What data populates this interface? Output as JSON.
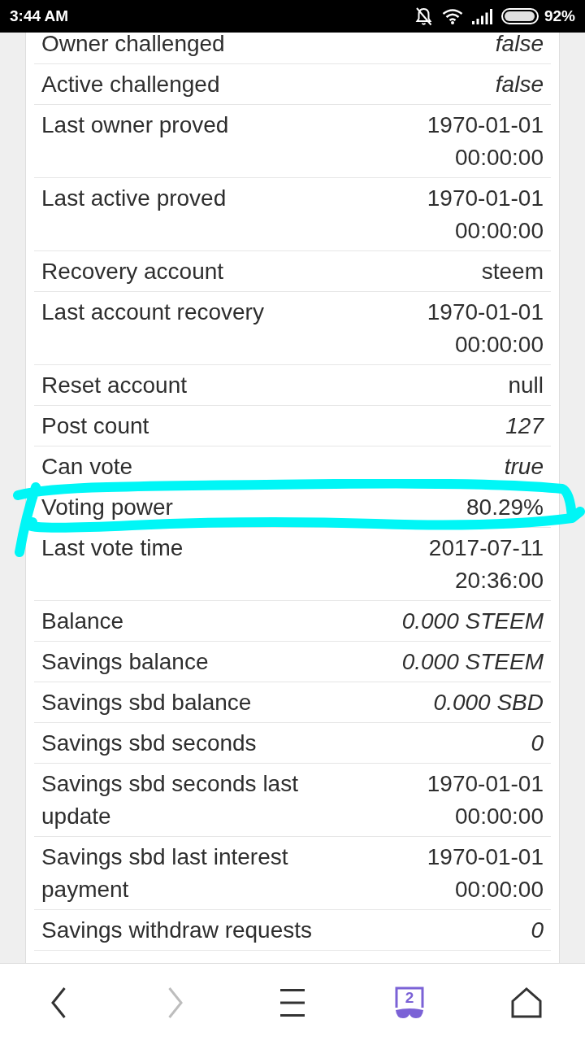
{
  "status_bar": {
    "time": "3:44 AM",
    "battery": "92%"
  },
  "rows": [
    {
      "label": "Owner challenged",
      "value": "false",
      "kind": "boolean",
      "highlighted": false
    },
    {
      "label": "Active challenged",
      "value": "false",
      "kind": "boolean",
      "highlighted": false
    },
    {
      "label": "Last owner proved",
      "value": "1970-01-01 00:00:00",
      "kind": "date",
      "highlighted": false
    },
    {
      "label": "Last active proved",
      "value": "1970-01-01 00:00:00",
      "kind": "date",
      "highlighted": false
    },
    {
      "label": "Recovery account",
      "value": "steem",
      "kind": "string",
      "highlighted": false
    },
    {
      "label": "Last account recovery",
      "value": "1970-01-01 00:00:00",
      "kind": "date",
      "highlighted": false
    },
    {
      "label": "Reset account",
      "value": "null",
      "kind": "string",
      "highlighted": false
    },
    {
      "label": "Post count",
      "value": "127",
      "kind": "number",
      "highlighted": false
    },
    {
      "label": "Can vote",
      "value": "true",
      "kind": "boolean",
      "highlighted": false
    },
    {
      "label": "Voting power",
      "value": "80.29%",
      "kind": "string",
      "highlighted": true
    },
    {
      "label": "Last vote time",
      "value": "2017-07-11 20:36:00",
      "kind": "date",
      "highlighted": false
    },
    {
      "label": "Balance",
      "value": "0.000 STEEM",
      "kind": "amount",
      "highlighted": false
    },
    {
      "label": "Savings balance",
      "value": "0.000 STEEM",
      "kind": "amount",
      "highlighted": false
    },
    {
      "label": "Savings sbd balance",
      "value": "0.000 SBD",
      "kind": "amount",
      "highlighted": false
    },
    {
      "label": "Savings sbd seconds",
      "value": "0",
      "kind": "number",
      "highlighted": false
    },
    {
      "label": "Savings sbd seconds last update",
      "value": "1970-01-01 00:00:00",
      "kind": "date",
      "highlighted": false
    },
    {
      "label": "Savings sbd last interest payment",
      "value": "1970-01-01 00:00:00",
      "kind": "date",
      "highlighted": false
    },
    {
      "label": "Savings withdraw requests",
      "value": "0",
      "kind": "number",
      "highlighted": false
    }
  ],
  "toolbar": [
    {
      "kind": "back",
      "disabled": false
    },
    {
      "kind": "forward",
      "disabled": true
    },
    {
      "kind": "menu",
      "disabled": false
    },
    {
      "kind": "tabs",
      "disabled": false,
      "count": "2"
    },
    {
      "kind": "home",
      "disabled": false
    }
  ]
}
